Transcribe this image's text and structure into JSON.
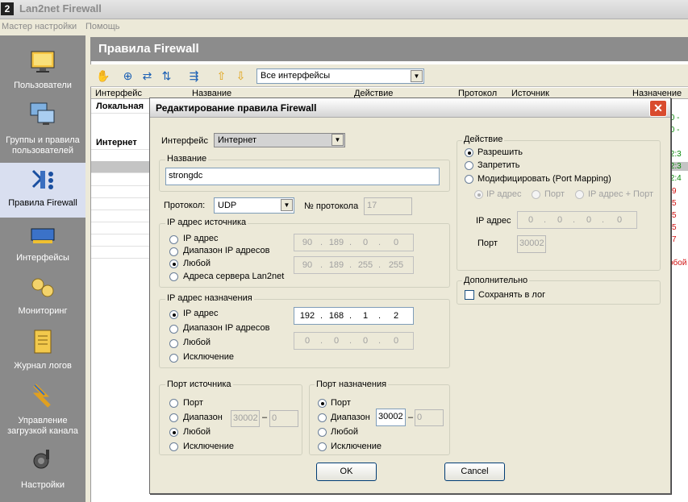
{
  "app": {
    "icon_text": "2",
    "title": "Lan2net Firewall"
  },
  "menu": [
    "Мастер настройки",
    "Помощь"
  ],
  "sidebar": {
    "items": [
      {
        "label": "Пользователи",
        "icon": "monitor-icon"
      },
      {
        "label": "Группы и правила пользователей",
        "icon": "computers-icon"
      },
      {
        "label": "Правила Firewall",
        "icon": "firewall-rules-icon"
      },
      {
        "label": "Интерфейсы",
        "icon": "network-card-icon"
      },
      {
        "label": "Мониторинг",
        "icon": "monitoring-icon"
      },
      {
        "label": "Журнал логов",
        "icon": "log-journal-icon"
      },
      {
        "label": "Управление загрузкой канала",
        "icon": "bandwidth-icon"
      },
      {
        "label": "Настройки",
        "icon": "gear-icon"
      }
    ],
    "active_index": 2
  },
  "main": {
    "title": "Правила Firewall",
    "interface_filter": "Все интерфейсы",
    "columns": [
      "Интерфейс",
      "Название",
      "Действие",
      "Протокол",
      "Источник",
      "Назначение"
    ],
    "groups": [
      "Локальная",
      "Интернет"
    ],
    "right_fragments": [
      ".0 -",
      ".0 -",
      ".2:3",
      ".2:3",
      ".2:4",
      "9",
      "5",
      "5",
      "5",
      "7",
      "обой"
    ]
  },
  "dialog": {
    "title": "Редактирование правила Firewall",
    "interface_label": "Интерфейс",
    "interface_value": "Интернет",
    "name_legend": "Название",
    "name_value": "strongdc",
    "protocol_label": "Протокол:",
    "protocol_value": "UDP",
    "protocol_no_label": "№ протокола",
    "protocol_no_value": "17",
    "src_ip": {
      "legend": "IP адрес источника",
      "options": [
        "IP адрес",
        "Диапазон IP адресов",
        "Любой",
        "Адреса сервера Lan2net"
      ],
      "selected": 2,
      "ip1": [
        "90",
        "189",
        "0",
        "0"
      ],
      "ip2": [
        "90",
        "189",
        "255",
        "255"
      ]
    },
    "dst_ip": {
      "legend": "IP адрес назначения",
      "options": [
        "IP адрес",
        "Диапазон IP адресов",
        "Любой",
        "Исключение"
      ],
      "selected": 0,
      "ip1": [
        "192",
        "168",
        "1",
        "2"
      ],
      "ip2": [
        "0",
        "0",
        "0",
        "0"
      ]
    },
    "src_port": {
      "legend": "Порт источника",
      "options": [
        "Порт",
        "Диапазон",
        "Любой",
        "Исключение"
      ],
      "selected": 2,
      "from": "30002",
      "to": "0"
    },
    "dst_port": {
      "legend": "Порт назначения",
      "options": [
        "Порт",
        "Диапазон",
        "Любой",
        "Исключение"
      ],
      "selected": 0,
      "from": "30002",
      "to": "0"
    },
    "action": {
      "legend": "Действие",
      "options": [
        "Разрешить",
        "Запретить",
        "Модифицировать (Port Mapping)"
      ],
      "selected": 0,
      "mapping_options": [
        "IP адрес",
        "Порт",
        "IP адрес + Порт"
      ],
      "ip_label": "IP адрес",
      "ip": [
        "0",
        "0",
        "0",
        "0"
      ],
      "port_label": "Порт",
      "port_value": "30002"
    },
    "extra": {
      "legend": "Дополнительно",
      "log_label": "Сохранять в лог"
    },
    "ok_label": "OK",
    "cancel_label": "Cancel",
    "dash": "–"
  }
}
